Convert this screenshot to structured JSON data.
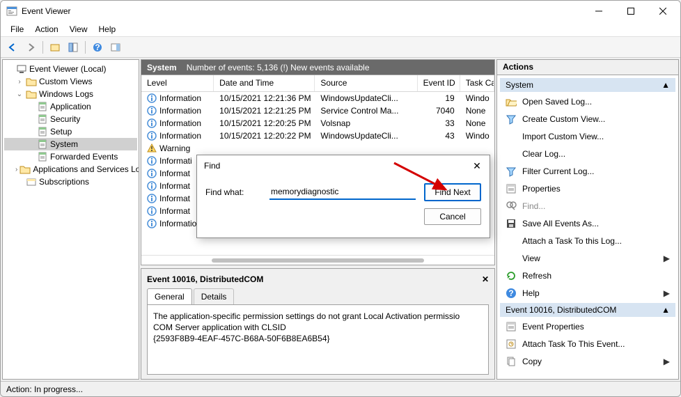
{
  "window": {
    "title": "Event Viewer"
  },
  "menu": [
    "File",
    "Action",
    "View",
    "Help"
  ],
  "tree": {
    "root": "Event Viewer (Local)",
    "items": [
      {
        "label": "Custom Views",
        "indent": 1,
        "toggle": ">",
        "icon": "folder"
      },
      {
        "label": "Windows Logs",
        "indent": 1,
        "toggle": "v",
        "icon": "folder"
      },
      {
        "label": "Application",
        "indent": 2,
        "toggle": "",
        "icon": "log"
      },
      {
        "label": "Security",
        "indent": 2,
        "toggle": "",
        "icon": "log"
      },
      {
        "label": "Setup",
        "indent": 2,
        "toggle": "",
        "icon": "log"
      },
      {
        "label": "System",
        "indent": 2,
        "toggle": "",
        "icon": "log",
        "selected": true
      },
      {
        "label": "Forwarded Events",
        "indent": 2,
        "toggle": "",
        "icon": "log"
      },
      {
        "label": "Applications and Services Lo",
        "indent": 1,
        "toggle": ">",
        "icon": "folder"
      },
      {
        "label": "Subscriptions",
        "indent": 1,
        "toggle": "",
        "icon": "sub"
      }
    ]
  },
  "mid_header": {
    "name": "System",
    "info": "Number of events: 5,136 (!) New events available"
  },
  "columns": [
    "Level",
    "Date and Time",
    "Source",
    "Event ID",
    "Task Ca"
  ],
  "rows": [
    {
      "lvl": "Information",
      "dt": "10/15/2021 12:21:36 PM",
      "src": "WindowsUpdateCli...",
      "id": "19",
      "task": "Windo"
    },
    {
      "lvl": "Information",
      "dt": "10/15/2021 12:21:25 PM",
      "src": "Service Control Ma...",
      "id": "7040",
      "task": "None"
    },
    {
      "lvl": "Information",
      "dt": "10/15/2021 12:20:25 PM",
      "src": "Volsnap",
      "id": "33",
      "task": "None"
    },
    {
      "lvl": "Information",
      "dt": "10/15/2021 12:20:22 PM",
      "src": "WindowsUpdateCli...",
      "id": "43",
      "task": "Windo"
    },
    {
      "lvl": "Warning",
      "dt": "",
      "src": "",
      "id": "",
      "task": ""
    },
    {
      "lvl": "Informati",
      "dt": "",
      "src": "",
      "id": "",
      "task": ""
    },
    {
      "lvl": "Informat",
      "dt": "",
      "src": "",
      "id": "",
      "task": ""
    },
    {
      "lvl": "Informat",
      "dt": "",
      "src": "",
      "id": "",
      "task": ""
    },
    {
      "lvl": "Informat",
      "dt": "",
      "src": "",
      "id": "",
      "task": ""
    },
    {
      "lvl": "Informat",
      "dt": "",
      "src": "",
      "id": "",
      "task": ""
    },
    {
      "lvl": "Information",
      "dt": "",
      "src": "",
      "id": "",
      "task": ""
    }
  ],
  "detail": {
    "title": "Event 10016, DistributedCOM",
    "tabs": [
      "General",
      "Details"
    ],
    "lines": [
      "The application-specific permission settings do not grant Local Activation permissio",
      "COM Server application with CLSID",
      "{2593F8B9-4EAF-457C-B68A-50F6B8EA6B54}"
    ]
  },
  "actions": {
    "title": "Actions",
    "group1": "System",
    "items1": [
      {
        "label": "Open Saved Log...",
        "icon": "open"
      },
      {
        "label": "Create Custom View...",
        "icon": "filter"
      },
      {
        "label": "Import Custom View...",
        "icon": "none"
      },
      {
        "label": "Clear Log...",
        "icon": "none"
      },
      {
        "label": "Filter Current Log...",
        "icon": "filter"
      },
      {
        "label": "Properties",
        "icon": "props"
      },
      {
        "label": "Find...",
        "icon": "find",
        "disabled": true
      },
      {
        "label": "Save All Events As...",
        "icon": "save"
      },
      {
        "label": "Attach a Task To this Log...",
        "icon": "none"
      },
      {
        "label": "View",
        "icon": "none",
        "arrow": true
      },
      {
        "label": "Refresh",
        "icon": "refresh"
      },
      {
        "label": "Help",
        "icon": "help",
        "arrow": true
      }
    ],
    "group2": "Event 10016, DistributedCOM",
    "items2": [
      {
        "label": "Event Properties",
        "icon": "props"
      },
      {
        "label": "Attach Task To This Event...",
        "icon": "task"
      },
      {
        "label": "Copy",
        "icon": "copy",
        "arrow": true
      }
    ]
  },
  "find": {
    "title": "Find",
    "label": "Find what:",
    "value": "memorydiagnostic",
    "next": "Find Next",
    "cancel": "Cancel"
  },
  "status": "Action:  In progress..."
}
